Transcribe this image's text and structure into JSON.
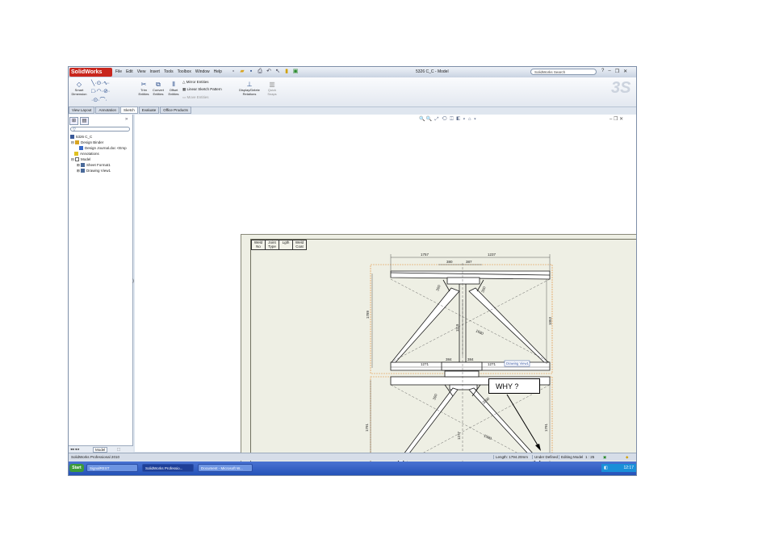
{
  "titlebar": {
    "app_name": "SolidWorks",
    "menus": [
      "File",
      "Edit",
      "View",
      "Insert",
      "Tools",
      "Toolbox",
      "Window",
      "Help"
    ],
    "document_title": "5326 C_C - Model",
    "search_placeholder": "SolidWorks Search"
  },
  "ribbon": {
    "smart_dimension": "Smart Dimension",
    "trim_entities": "Trim Entities",
    "convert_entities": "Convert Entities",
    "offset_entities": "Offset Entities",
    "mirror_entities": "Mirror Entities",
    "linear_sketch_pattern": "Linear Sketch Pattern",
    "move_entities": "Move Entities",
    "display_delete_relations": "Display/Delete Relations",
    "quick_snaps": "Quick Snaps"
  },
  "command_tabs": [
    "View Layout",
    "Annotation",
    "Sketch",
    "Evaluate",
    "Office Products"
  ],
  "active_tab": "Sketch",
  "tree": {
    "root": "5326 C_C",
    "items": [
      "Design Binder",
      "Design Journal.doc <Emp",
      "Annotations",
      "Model",
      "Sheet Format1",
      "Drawing View1"
    ]
  },
  "left_bottom_tab": "Model",
  "weld_table": {
    "headers": [
      "Weld No",
      "Joint Type",
      "Lgth",
      "Weld Coat"
    ]
  },
  "drawing": {
    "dims_top": [
      "1757",
      "1237"
    ],
    "dims_mid_top": [
      "380",
      "387"
    ],
    "dim_left_height": "1789",
    "dim_right_height": "1053",
    "dim_center": "1119",
    "dims_middle": [
      "1271",
      "384",
      "384",
      "1271"
    ],
    "dims_lower": [
      "1791",
      "1791",
      "1277"
    ],
    "dims_bottom": [
      "1271",
      "1817"
    ],
    "view_label": "Drawing View1",
    "diag_labels": [
      "300",
      "300",
      "1680",
      "300",
      "2090",
      "1590"
    ]
  },
  "statusbar": {
    "left": "SolidWorks Professional 2010",
    "length": "Length: 1794.20mm",
    "state": "Under Defined",
    "editing": "Editing Model",
    "scale": "1 : 25"
  },
  "taskbar": {
    "start": "Start",
    "items": [
      "SignalREST",
      "SolidWorks Professio...",
      "Document - Microsoft W..."
    ],
    "clock": "12:17"
  },
  "callout": "WHY ?"
}
